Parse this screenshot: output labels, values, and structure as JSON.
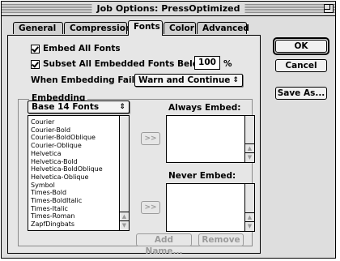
{
  "window": {
    "title": "Job Options: PressOptimized"
  },
  "tabs": [
    {
      "label": "General"
    },
    {
      "label": "Compression"
    },
    {
      "label": "Fonts"
    },
    {
      "label": "Color"
    },
    {
      "label": "Advanced"
    }
  ],
  "fonts": {
    "embed_all_label": "Embed All Fonts",
    "embed_all_checked": true,
    "subset_label": "Subset All Embedded Fonts Below:",
    "subset_checked": true,
    "subset_value": "100",
    "subset_unit": "%",
    "when_fails_label": "When Embedding Fails:",
    "when_fails_value": "Warn and Continue",
    "embedding_group_label": "Embedding",
    "font_set_value": "Base 14 Fonts",
    "font_list": [
      "Courier",
      "Courier-Bold",
      "Courier-BoldOblique",
      "Courier-Oblique",
      "Helvetica",
      "Helvetica-Bold",
      "Helvetica-BoldOblique",
      "Helvetica-Oblique",
      "Symbol",
      "Times-Bold",
      "Times-BoldItalic",
      "Times-Italic",
      "Times-Roman",
      "ZapfDingbats"
    ],
    "always_embed_label": "Always Embed:",
    "never_embed_label": "Never Embed:",
    "move_button_label": ">>",
    "add_name_label": "Add Name...",
    "remove_label": "Remove"
  },
  "buttons": {
    "ok": "OK",
    "cancel": "Cancel",
    "save_as": "Save As..."
  },
  "icons": {
    "popup_arrow": "⇕",
    "scroll_up": "▲",
    "scroll_down": "▼"
  }
}
